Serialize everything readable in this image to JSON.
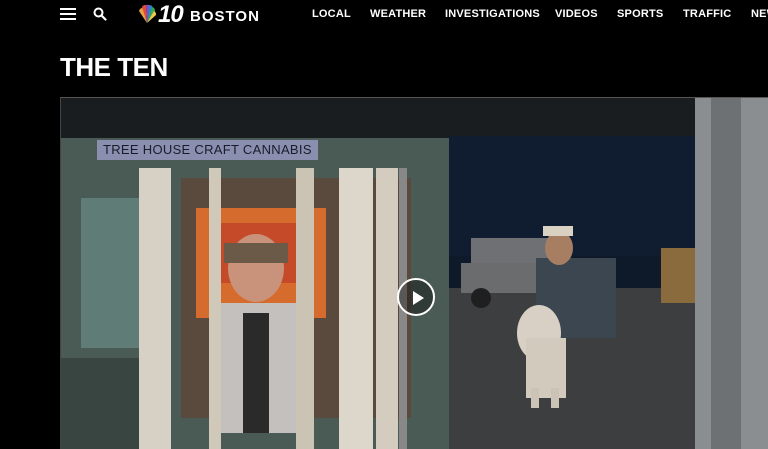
{
  "header": {
    "logo_number": "10",
    "logo_city": "BOSTON",
    "nav": [
      "LOCAL",
      "WEATHER",
      "INVESTIGATIONS",
      "VIDEOS",
      "SPORTS",
      "TRAFFIC",
      "NEWS"
    ]
  },
  "page": {
    "title": "THE TEN"
  },
  "video": {
    "chyron": "TREE HOUSE CRAFT CANNABIS"
  },
  "icons": {
    "menu": "hamburger-menu-icon",
    "search": "search-icon",
    "logo": "nbc-peacock-icon",
    "play": "play-icon"
  },
  "colors": {
    "background": "#000000",
    "chyron_bg": "#8a8fb0",
    "chyron_text": "#1a1c2a"
  }
}
